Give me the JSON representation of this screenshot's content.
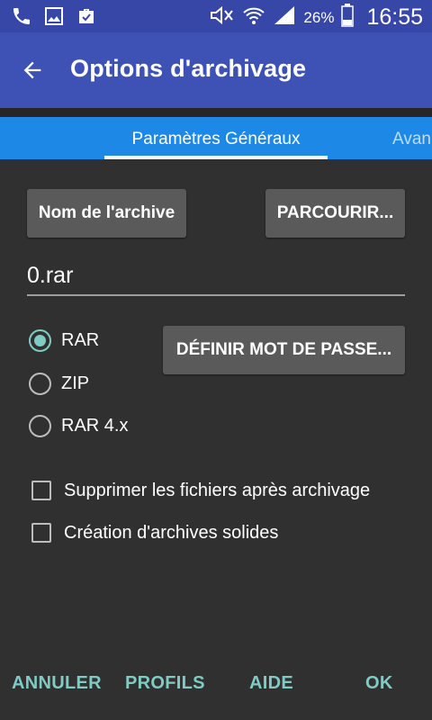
{
  "status_bar": {
    "icons_left": [
      "phone-icon",
      "image-icon",
      "briefcase-icon"
    ],
    "icons_right": [
      "mute-icon",
      "wifi-icon",
      "signal-icon",
      "battery-icon"
    ],
    "battery_percent": "26%",
    "time": "16:55"
  },
  "toolbar": {
    "back_icon": "arrow-back-icon",
    "title": "Options d'archivage"
  },
  "tabs": {
    "active_label": "Paramètres Généraux",
    "next_label": "Avan"
  },
  "main": {
    "archive_name_button": "Nom de l'archive",
    "browse_button": "PARCOURIR...",
    "archive_name_value": "0.rar",
    "set_password_button": "DÉFINIR MOT DE PASSE...",
    "formats": [
      {
        "label": "RAR",
        "checked": true
      },
      {
        "label": "ZIP",
        "checked": false
      },
      {
        "label": "RAR 4.x",
        "checked": false
      }
    ],
    "options": [
      {
        "label": "Supprimer les fichiers après archivage",
        "checked": false
      },
      {
        "label": "Création d'archives solides",
        "checked": false
      }
    ]
  },
  "footer": {
    "cancel": "ANNULER",
    "profiles": "PROFILS",
    "help": "AIDE",
    "ok": "OK"
  },
  "colors": {
    "status_bar": "#3747a8",
    "toolbar": "#3e51b5",
    "tab_bar": "#1d88e5",
    "background": "#303030",
    "button": "#5a5a5a",
    "accent": "#80cbc4"
  }
}
